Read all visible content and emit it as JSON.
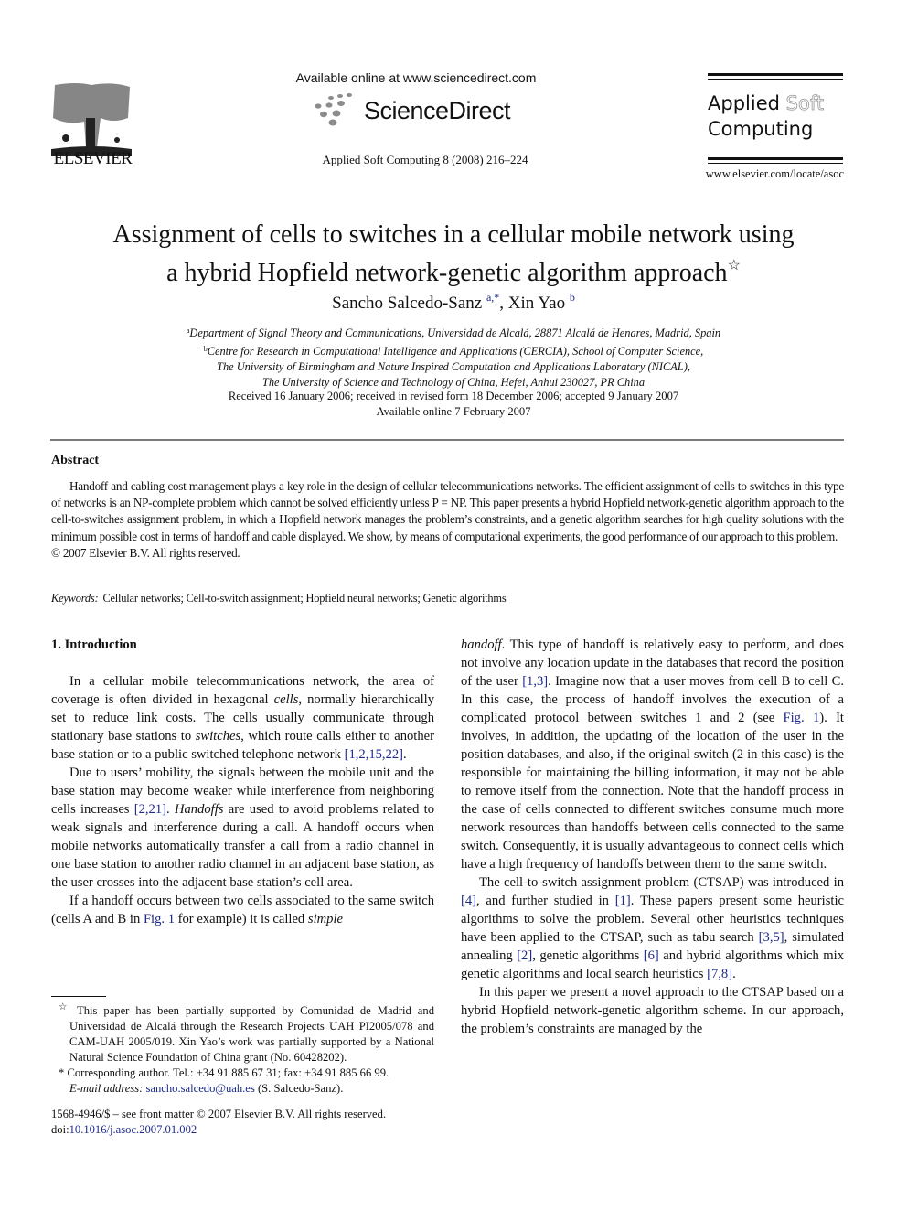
{
  "header": {
    "publisher_logo_word": "ELSEVIER",
    "available_online": "Available online at www.sciencedirect.com",
    "sciencedirect_word": "ScienceDirect",
    "journal_reference": "Applied Soft Computing 8 (2008) 216–224",
    "journal_logo": {
      "line1_a": "Applied",
      "line1_b": "Soft",
      "line2": "Computing"
    },
    "journal_url": "www.elsevier.com/locate/asoc"
  },
  "article": {
    "title_line1": "Assignment of cells to switches in a cellular mobile network using",
    "title_line2": "a hybrid Hopfield network-genetic algorithm approach",
    "title_mark": "☆",
    "authors": [
      {
        "name": "Sancho Salcedo-Sanz",
        "sup": "a,*"
      },
      {
        "name": "Xin Yao",
        "sup": "b"
      }
    ],
    "author_separator": ", ",
    "affiliations": [
      {
        "sup": "a",
        "text": "Department of Signal Theory and Communications, Universidad de Alcalá, 28871 Alcalá de Henares, Madrid, Spain"
      },
      {
        "sup": "b",
        "text": "Centre for Research in Computational Intelligence and Applications (CERCIA), School of Computer Science,"
      },
      {
        "sup": "",
        "text": "The University of Birmingham and Nature Inspired Computation and Applications Laboratory (NICAL),"
      },
      {
        "sup": "",
        "text": "The University of Science and Technology of China, Hefei, Anhui 230027, PR China"
      }
    ],
    "received": "Received 16 January 2006; received in revised form 18 December 2006; accepted 9 January 2007",
    "available": "Available online 7 February 2007"
  },
  "abstract": {
    "heading": "Abstract",
    "text": "Handoff and cabling cost management plays a key role in the design of cellular telecommunications networks. The efficient assignment of cells to switches in this type of networks is an NP-complete problem which cannot be solved efficiently unless P = NP. This paper presents a hybrid Hopfield network-genetic algorithm approach to the cell-to-switches assignment problem, in which a Hopfield network manages the problem’s constraints, and a genetic algorithm searches for high quality solutions with the minimum possible cost in terms of handoff and cable displayed. We show, by means of computational experiments, the good performance of our approach to this problem.",
    "copyright": "© 2007 Elsevier B.V. All rights reserved.",
    "keywords_label": "Keywords:",
    "keywords": "Cellular networks; Cell-to-switch assignment; Hopfield neural networks; Genetic algorithms"
  },
  "intro": {
    "heading": "1.  Introduction",
    "p1": {
      "a": "In a cellular mobile telecommunications network, the area of coverage is often divided in hexagonal ",
      "em1": "cells",
      "b": ", normally hierarchically set to reduce link costs. The cells usually communicate through stationary base stations to ",
      "em2": "switches",
      "c": ", which route calls either to another base station or to a public switched telephone network ",
      "ref1": "[1,2,15,22]",
      "d": "."
    },
    "p2": {
      "a": "Due to users’ mobility, the signals between the mobile unit and the base station may become weaker while interference from neighboring cells increases ",
      "ref1": "[2,21]",
      "b": ". ",
      "em1": "Handoffs",
      "c": " are used to avoid problems related to weak signals and interference during a call. A handoff occurs when mobile networks automatically transfer a call from a radio channel in one base station to another radio channel in an adjacent base station, as the user crosses into the adjacent base station’s cell area."
    },
    "p3": {
      "a": "If a handoff occurs between two cells associated to the same switch (cells A and B in ",
      "ref1": "Fig. 1",
      "b": " for example) it is called ",
      "em1": "simple handoff",
      "c": ". This type of handoff is relatively easy to perform, and does not involve any location update in the databases that record the position of the user ",
      "ref2": "[1,3]",
      "d": ". Imagine now that a user moves from cell B to cell C. In this case, the process of handoff involves the execution of a complicated protocol between switches 1 and 2 (see ",
      "ref3": "Fig. 1",
      "e": "). It involves, in addition, the updating of the location of the user in the position databases, and also, if the original switch (2 in this case) is the responsible for maintaining the billing information, it may not be able to remove itself from the connection. Note that the handoff process in the case of cells connected to different switches consume much more network resources than handoffs between cells connected to the same switch. Consequently, it is usually advantageous to connect cells which have a high frequency of handoffs between them to the same switch."
    },
    "p4": {
      "a": "The cell-to-switch assignment problem (CTSAP) was introduced in ",
      "ref1": "[4]",
      "b": ", and further studied in ",
      "ref2": "[1]",
      "c": ". These papers present some heuristic algorithms to solve the problem. Several other heuristics techniques have been applied to the CTSAP, such as tabu search ",
      "ref3": "[3,5]",
      "d": ", simulated annealing ",
      "ref4": "[2]",
      "e": ", genetic algorithms ",
      "ref5": "[6]",
      "f": " and hybrid algorithms which mix genetic algorithms and local search heuristics ",
      "ref6": "[7,8]",
      "g": "."
    },
    "p5": {
      "a": "In this paper we present a novel approach to the CTSAP based on a hybrid Hopfield network-genetic algorithm scheme. In our approach, the problem’s constraints are managed by the"
    }
  },
  "footnotes": {
    "star_mark": "☆",
    "star_text": "This paper has been partially supported by Comunidad de Madrid and Universidad de Alcalá through the Research Projects UAH PI2005/078 and CAM-UAH 2005/019. Xin Yao’s work was partially supported by a National Natural Science Foundation of China grant (No. 60428202).",
    "corr_mark": "*",
    "corr_text": "Corresponding author. Tel.: +34 91 885 67 31; fax: +34 91 885 66 99.",
    "email_label": "E-mail address:",
    "email": "sancho.salcedo@uah.es",
    "email_suffix": " (S. Salcedo-Sanz).",
    "front_matter": "1568-4946/$ – see front matter © 2007 Elsevier B.V. All rights reserved.",
    "doi_label": "doi:",
    "doi": "10.1016/j.asoc.2007.01.002"
  },
  "colors": {
    "link": "#1d2a8a",
    "rule": "#7a7a7a",
    "text": "#111111"
  }
}
